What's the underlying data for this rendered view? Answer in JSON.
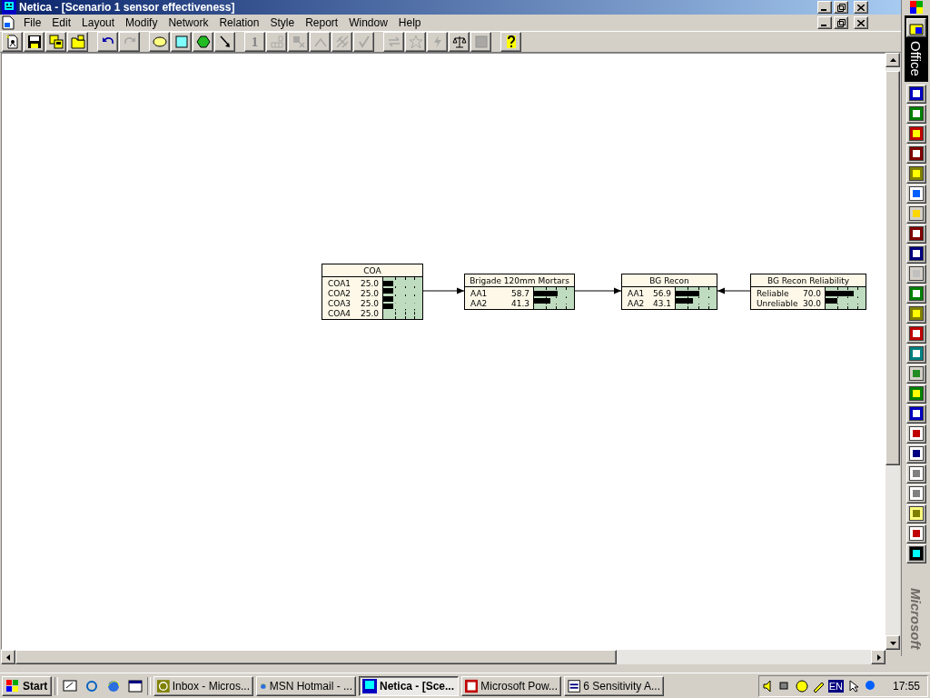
{
  "window": {
    "title": "Netica - [Scenario 1 sensor effectiveness]"
  },
  "menu": [
    "File",
    "Edit",
    "Layout",
    "Modify",
    "Network",
    "Relation",
    "Style",
    "Report",
    "Window",
    "Help"
  ],
  "toolbar": [
    {
      "kind": "new",
      "disabled": false
    },
    {
      "kind": "save",
      "disabled": false
    },
    {
      "kind": "saveas",
      "disabled": false
    },
    {
      "kind": "open",
      "disabled": false
    },
    {
      "kind": "sep"
    },
    {
      "kind": "undo",
      "disabled": false
    },
    {
      "kind": "redo",
      "disabled": true
    },
    {
      "kind": "sep"
    },
    {
      "kind": "oval",
      "disabled": false
    },
    {
      "kind": "rect",
      "disabled": false
    },
    {
      "kind": "hex",
      "disabled": false
    },
    {
      "kind": "arrow",
      "disabled": false
    },
    {
      "kind": "sep"
    },
    {
      "kind": "text",
      "label": "1",
      "disabled": true
    },
    {
      "kind": "grid",
      "disabled": true
    },
    {
      "kind": "pin",
      "disabled": true
    },
    {
      "kind": "roof",
      "disabled": true
    },
    {
      "kind": "cross",
      "disabled": true
    },
    {
      "kind": "check",
      "disabled": true
    },
    {
      "kind": "sep"
    },
    {
      "kind": "swap",
      "disabled": true
    },
    {
      "kind": "star",
      "disabled": true
    },
    {
      "kind": "bolt",
      "disabled": true
    },
    {
      "kind": "scale",
      "disabled": false
    },
    {
      "kind": "frame",
      "disabled": true
    },
    {
      "kind": "sep"
    },
    {
      "kind": "help",
      "disabled": false
    }
  ],
  "nodes": [
    {
      "title": "COA",
      "states": [
        {
          "name": "COA1",
          "value": "25.0",
          "level": 0.25
        },
        {
          "name": "COA2",
          "value": "25.0",
          "level": 0.25
        },
        {
          "name": "COA3",
          "value": "25.0",
          "level": 0.25
        },
        {
          "name": "COA4",
          "value": "25.0",
          "level": 0.25
        }
      ]
    },
    {
      "title": "Brigade 120mm Mortars",
      "states": [
        {
          "name": "AA1",
          "value": "58.7",
          "level": 0.587
        },
        {
          "name": "AA2",
          "value": "41.3",
          "level": 0.413
        }
      ]
    },
    {
      "title": "BG Recon",
      "states": [
        {
          "name": "AA1",
          "value": "56.9",
          "level": 0.569
        },
        {
          "name": "AA2",
          "value": "43.1",
          "level": 0.431
        }
      ]
    },
    {
      "title": "BG Recon Reliability",
      "states": [
        {
          "name": "Reliable",
          "value": "70.0",
          "level": 0.7
        },
        {
          "name": "Unreliable",
          "value": "30.0",
          "level": 0.3
        }
      ]
    }
  ],
  "office_bar": {
    "title": "Office",
    "footer": "Microsoft"
  },
  "taskbar": {
    "start": "Start",
    "tasks": [
      {
        "label": "Inbox - Micros...",
        "kind": "clock",
        "selected": false
      },
      {
        "label": "MSN Hotmail - ...",
        "kind": "browser",
        "selected": false
      },
      {
        "label": "Netica - [Sce...",
        "kind": "netica",
        "selected": true
      },
      {
        "label": "Microsoft Pow...",
        "kind": "slides",
        "selected": false
      },
      {
        "label": "6 Sensitivity A...",
        "kind": "doc",
        "selected": false
      }
    ],
    "language": "EN",
    "clock": "17:55"
  }
}
